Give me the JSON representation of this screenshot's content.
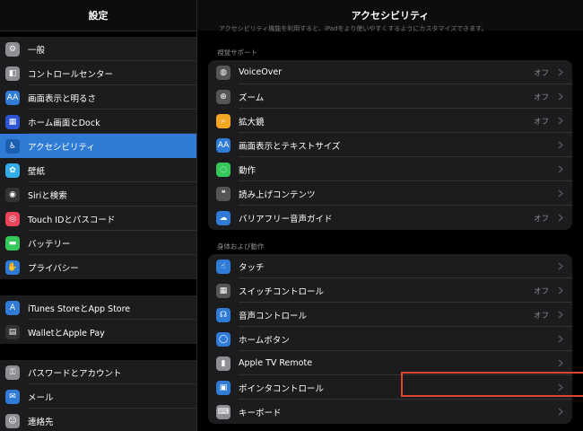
{
  "sidebar": {
    "title": "設定",
    "groups": [
      [
        {
          "label": "一般",
          "icon": "gear-icon",
          "color": "#8e8e93"
        },
        {
          "label": "コントロールセンター",
          "icon": "toggles-icon",
          "color": "#8e8e93"
        },
        {
          "label": "画面表示と明るさ",
          "icon": "text-size-icon",
          "color": "#2f7bd6"
        },
        {
          "label": "ホーム画面とDock",
          "icon": "grid-icon",
          "color": "#2f54d6"
        },
        {
          "label": "アクセシビリティ",
          "icon": "accessibility-icon",
          "color": "#2f7bd6",
          "selected": true
        },
        {
          "label": "壁紙",
          "icon": "flower-icon",
          "color": "#32ade6"
        },
        {
          "label": "Siriと検索",
          "icon": "siri-icon",
          "color": "#333"
        },
        {
          "label": "Touch IDとパスコード",
          "icon": "fingerprint-icon",
          "color": "#e9445a"
        },
        {
          "label": "バッテリー",
          "icon": "battery-icon",
          "color": "#34c759"
        },
        {
          "label": "プライバシー",
          "icon": "hand-icon",
          "color": "#2f7bd6"
        }
      ],
      [
        {
          "label": "iTunes StoreとApp Store",
          "icon": "app-store-icon",
          "color": "#2f7bd6"
        },
        {
          "label": "WalletとApple Pay",
          "icon": "wallet-icon",
          "color": "#333"
        }
      ],
      [
        {
          "label": "パスワードとアカウント",
          "icon": "key-icon",
          "color": "#8e8e93"
        },
        {
          "label": "メール",
          "icon": "mail-icon",
          "color": "#2f7bd6"
        },
        {
          "label": "連絡先",
          "icon": "contacts-icon",
          "color": "#8e8e93"
        }
      ]
    ]
  },
  "main": {
    "title": "アクセシビリティ",
    "description": "アクセシビリティ機能を利用すると、iPadをより使いやすくするようにカスタマイズできます。",
    "sections": [
      {
        "label": "視覚サポート",
        "rows": [
          {
            "label": "VoiceOver",
            "value": "オフ",
            "icon": "voiceover-icon",
            "color": "#555"
          },
          {
            "label": "ズーム",
            "value": "オフ",
            "icon": "zoom-icon",
            "color": "#555"
          },
          {
            "label": "拡大鏡",
            "value": "オフ",
            "icon": "magnifier-icon",
            "color": "#f5a623"
          },
          {
            "label": "画面表示とテキストサイズ",
            "value": "",
            "icon": "text-size-icon",
            "color": "#2f7bd6"
          },
          {
            "label": "動作",
            "value": "",
            "icon": "motion-icon",
            "color": "#34c759"
          },
          {
            "label": "読み上げコンテンツ",
            "value": "",
            "icon": "speech-bubble-icon",
            "color": "#555"
          },
          {
            "label": "バリアフリー音声ガイド",
            "value": "オフ",
            "icon": "audio-description-icon",
            "color": "#2f7bd6"
          }
        ]
      },
      {
        "label": "身体および動作",
        "rows": [
          {
            "label": "タッチ",
            "value": "",
            "icon": "touch-icon",
            "color": "#2f7bd6"
          },
          {
            "label": "スイッチコントロール",
            "value": "オフ",
            "icon": "switch-control-icon",
            "color": "#555"
          },
          {
            "label": "音声コントロール",
            "value": "オフ",
            "icon": "voice-control-icon",
            "color": "#2f7bd6"
          },
          {
            "label": "ホームボタン",
            "value": "",
            "icon": "home-button-icon",
            "color": "#2f7bd6"
          },
          {
            "label": "Apple TV Remote",
            "value": "",
            "icon": "remote-icon",
            "color": "#8e8e93"
          },
          {
            "label": "ポインタコントロール",
            "value": "",
            "icon": "pointer-icon",
            "color": "#2f7bd6"
          },
          {
            "label": "キーボード",
            "value": "",
            "icon": "keyboard-icon",
            "color": "#8e8e93"
          }
        ]
      }
    ]
  }
}
